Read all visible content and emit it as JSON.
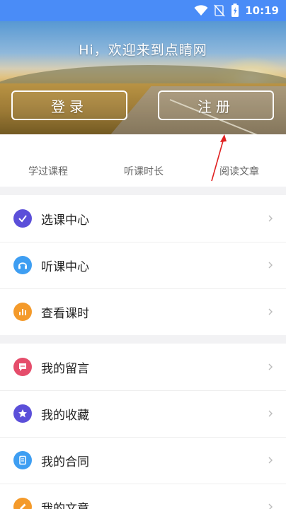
{
  "status_bar": {
    "time": "10:19",
    "icons": [
      "wifi-icon",
      "no-signal-icon",
      "battery-icon"
    ],
    "background": "#4a8cf7"
  },
  "hero": {
    "welcome_text": "Hi，欢迎来到点睛网",
    "login_label": "登录",
    "register_label": "注册"
  },
  "stats": {
    "items": [
      "学过课程",
      "听课时长",
      "阅读文章"
    ]
  },
  "menu_group_1": [
    {
      "label": "选课中心",
      "icon": "check-circle-icon",
      "color": "#5b4fd9"
    },
    {
      "label": "听课中心",
      "icon": "headphones-icon",
      "color": "#3e9ef2"
    },
    {
      "label": "查看课时",
      "icon": "bar-chart-icon",
      "color": "#f49a2a"
    }
  ],
  "menu_group_2": [
    {
      "label": "我的留言",
      "icon": "message-icon",
      "color": "#e54d6b"
    },
    {
      "label": "我的收藏",
      "icon": "star-icon",
      "color": "#5b4fd9"
    },
    {
      "label": "我的合同",
      "icon": "contract-icon",
      "color": "#3e9ef2"
    },
    {
      "label": "我的文章",
      "icon": "edit-icon",
      "color": "#f49a2a"
    }
  ],
  "accent_colors": {
    "arrow": "#e02020"
  }
}
